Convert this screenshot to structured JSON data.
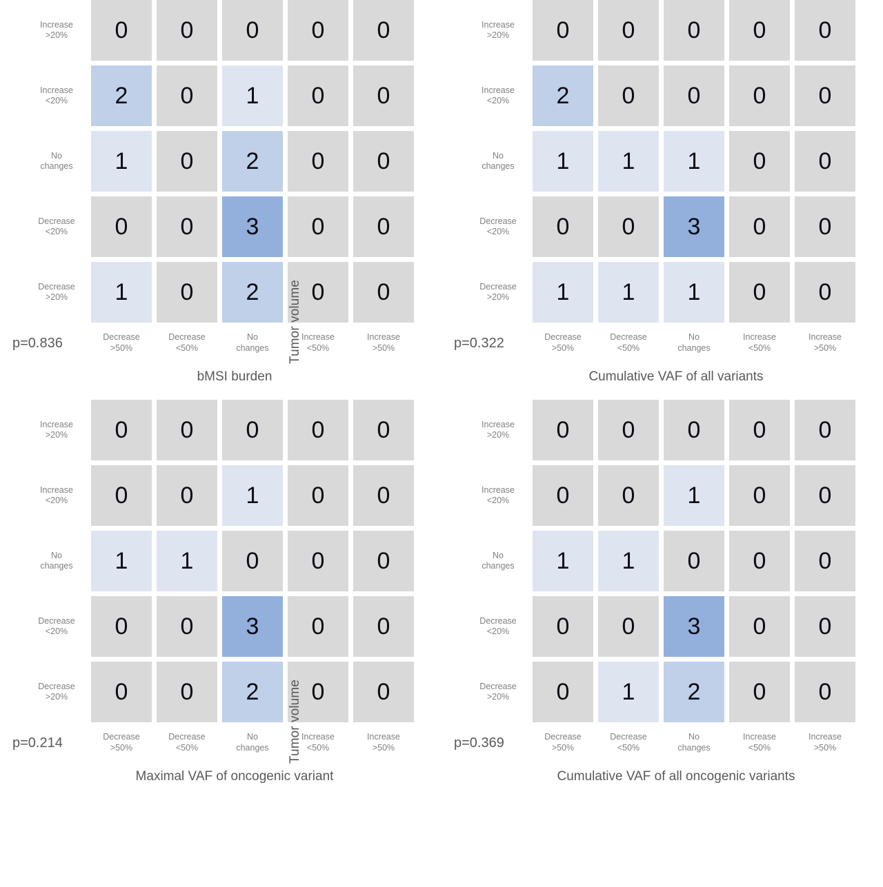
{
  "figure": {
    "y_axis_title": "Tumor volume",
    "row_labels": [
      [
        "Increase",
        ">20%"
      ],
      [
        "Increase",
        "<20%"
      ],
      [
        "No",
        "changes"
      ],
      [
        "Decrease",
        "<20%"
      ],
      [
        "Decrease",
        ">20%"
      ]
    ],
    "col_labels": [
      [
        "Decrease",
        ">50%"
      ],
      [
        "Decrease",
        "<50%"
      ],
      [
        "No",
        "changes"
      ],
      [
        "Increase",
        "<50%"
      ],
      [
        "Increase",
        ">50%"
      ]
    ],
    "colors": {
      "value_0": "#d9d9d9",
      "value_1": "#dfe4f1",
      "value_2": "#bfd0e8",
      "value_3": "#93b0dd",
      "cell_text": "#0c0c14",
      "tick_text": "#808080",
      "axis_title_text": "#595959",
      "background": "#ffffff"
    }
  },
  "chart_data": [
    {
      "type": "heatmap",
      "title": "bMSI burden",
      "xlabel": "bMSI burden",
      "ylabel": "Tumor volume",
      "annotation": "p=0.836",
      "p_value": 0.836,
      "x_categories": [
        "Decrease >50%",
        "Decrease <50%",
        "No changes",
        "Increase <50%",
        "Increase >50%"
      ],
      "y_categories": [
        "Increase >20%",
        "Increase <20%",
        "No changes",
        "Decrease <20%",
        "Decrease >20%"
      ],
      "values": [
        [
          0,
          0,
          0,
          0,
          0
        ],
        [
          2,
          0,
          1,
          0,
          0
        ],
        [
          1,
          0,
          2,
          0,
          0
        ],
        [
          0,
          0,
          3,
          0,
          0
        ],
        [
          1,
          0,
          2,
          0,
          0
        ]
      ],
      "grid": false,
      "legend": "none"
    },
    {
      "type": "heatmap",
      "title": "Cumulative VAF of all variants",
      "xlabel": "Cumulative VAF of all variants",
      "ylabel": "Tumor volume",
      "annotation": "p=0.322",
      "p_value": 0.322,
      "x_categories": [
        "Decrease >50%",
        "Decrease <50%",
        "No changes",
        "Increase <50%",
        "Increase >50%"
      ],
      "y_categories": [
        "Increase >20%",
        "Increase <20%",
        "No changes",
        "Decrease <20%",
        "Decrease >20%"
      ],
      "values": [
        [
          0,
          0,
          0,
          0,
          0
        ],
        [
          2,
          0,
          0,
          0,
          0
        ],
        [
          1,
          1,
          1,
          0,
          0
        ],
        [
          0,
          0,
          3,
          0,
          0
        ],
        [
          1,
          1,
          1,
          0,
          0
        ]
      ],
      "grid": false,
      "legend": "none"
    },
    {
      "type": "heatmap",
      "title": "Maximal VAF of oncogenic variant",
      "xlabel": "Maximal VAF of oncogenic variant",
      "ylabel": "Tumor volume",
      "annotation": "p=0.214",
      "p_value": 0.214,
      "x_categories": [
        "Decrease >50%",
        "Decrease <50%",
        "No changes",
        "Increase <50%",
        "Increase >50%"
      ],
      "y_categories": [
        "Increase >20%",
        "Increase <20%",
        "No changes",
        "Decrease <20%",
        "Decrease >20%"
      ],
      "values": [
        [
          0,
          0,
          0,
          0,
          0
        ],
        [
          0,
          0,
          1,
          0,
          0
        ],
        [
          1,
          1,
          0,
          0,
          0
        ],
        [
          0,
          0,
          3,
          0,
          0
        ],
        [
          0,
          0,
          2,
          0,
          0
        ]
      ],
      "grid": false,
      "legend": "none"
    },
    {
      "type": "heatmap",
      "title": "Cumulative VAF of all oncogenic variants",
      "xlabel": "Cumulative VAF of all oncogenic variants",
      "ylabel": "Tumor volume",
      "annotation": "p=0.369",
      "p_value": 0.369,
      "x_categories": [
        "Decrease >50%",
        "Decrease <50%",
        "No changes",
        "Increase <50%",
        "Increase >50%"
      ],
      "y_categories": [
        "Increase >20%",
        "Increase <20%",
        "No changes",
        "Decrease <20%",
        "Decrease >20%"
      ],
      "values": [
        [
          0,
          0,
          0,
          0,
          0
        ],
        [
          0,
          0,
          1,
          0,
          0
        ],
        [
          1,
          1,
          0,
          0,
          0
        ],
        [
          0,
          0,
          3,
          0,
          0
        ],
        [
          0,
          1,
          2,
          0,
          0
        ]
      ],
      "grid": false,
      "legend": "none"
    }
  ]
}
